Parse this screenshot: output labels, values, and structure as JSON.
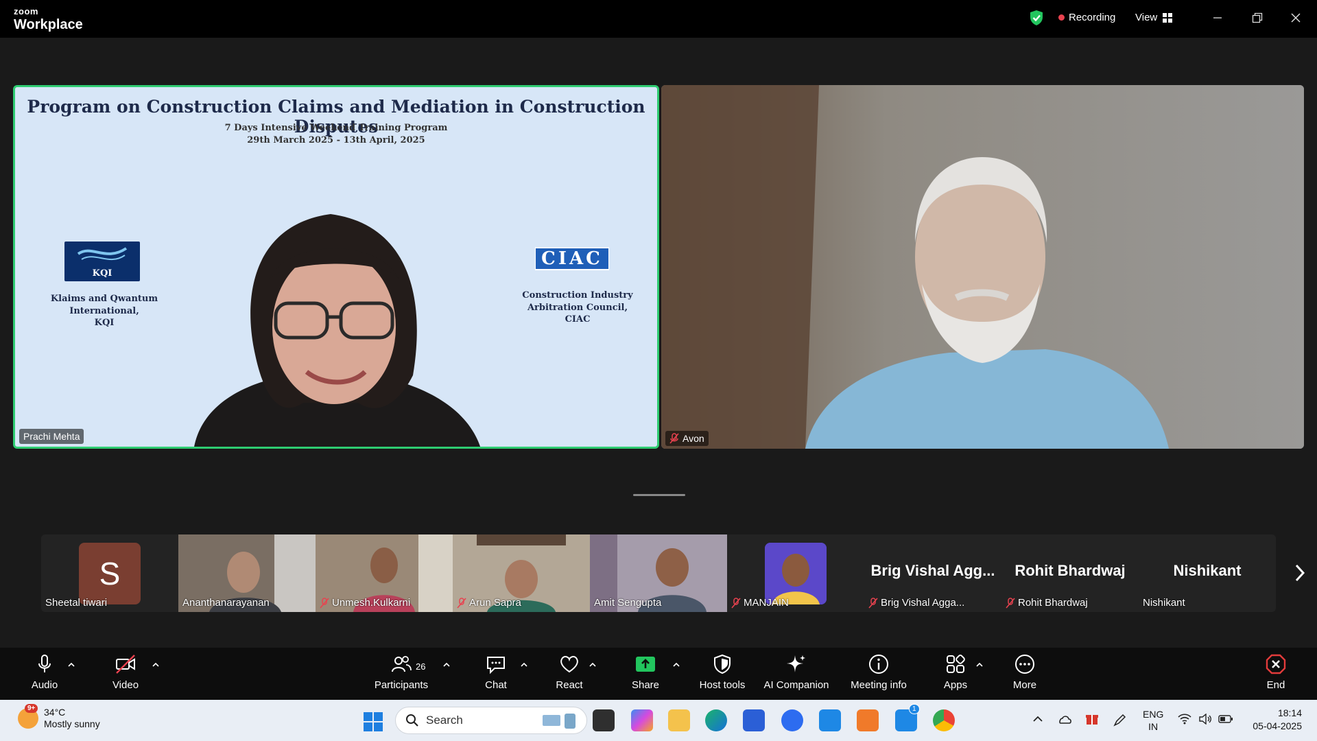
{
  "titlebar": {
    "brand_small": "zoom",
    "brand_big": "Workplace",
    "recording": "Recording",
    "view": "View"
  },
  "slide": {
    "title": "Program on Construction Claims and Mediation in Construction Disputes",
    "subtitle1": "7 Days Intensive Weekend Training Program",
    "subtitle2": "29th March 2025 - 13th April, 2025",
    "left_logo": "KQI",
    "left_org_line1": "Klaims and Qwantum",
    "left_org_line2": "International,",
    "left_org_line3": "KQI",
    "right_logo": "CIAC",
    "right_org_line1": "Construction Industry",
    "right_org_line2": "Arbitration Council,",
    "right_org_line3": "CIAC"
  },
  "main_tiles": [
    {
      "name": "Prachi Mehta",
      "muted": false
    },
    {
      "name": "Avon",
      "muted": true
    }
  ],
  "gallery": [
    {
      "name": "Sheetal tiwari",
      "muted": false,
      "initial": "S"
    },
    {
      "name": "Ananthanarayanan",
      "muted": false
    },
    {
      "name": "Unmesh.Kulkarni",
      "muted": true
    },
    {
      "name": "Arun Sapra",
      "muted": true
    },
    {
      "name": "Amit Sengupta",
      "muted": false
    },
    {
      "name": "MANJAIN",
      "muted": true
    },
    {
      "name": "Brig Vishal Agga...",
      "muted": true,
      "display": "Brig Vishal Agg..."
    },
    {
      "name": "Rohit Bhardwaj",
      "muted": true,
      "display": "Rohit Bhardwaj"
    },
    {
      "name": "Nishikant",
      "muted": false,
      "display": "Nishikant"
    }
  ],
  "toolbar": {
    "audio": "Audio",
    "video": "Video",
    "participants": "Participants",
    "participants_count": "26",
    "chat": "Chat",
    "react": "React",
    "share": "Share",
    "host_tools": "Host tools",
    "ai_companion": "AI Companion",
    "meeting_info": "Meeting info",
    "apps": "Apps",
    "more": "More",
    "end": "End"
  },
  "taskbar": {
    "temp": "34°C",
    "weather": "Mostly sunny",
    "weather_badge": "9+",
    "search": "Search",
    "lang1": "ENG",
    "lang2": "IN",
    "time": "18:14",
    "date": "05-04-2025",
    "todo_badge": "1"
  },
  "colors": {
    "active_speaker": "#2ecc71",
    "recording_dot": "#e8424f",
    "share_green": "#22c55e",
    "end_red": "#e23b3b"
  }
}
